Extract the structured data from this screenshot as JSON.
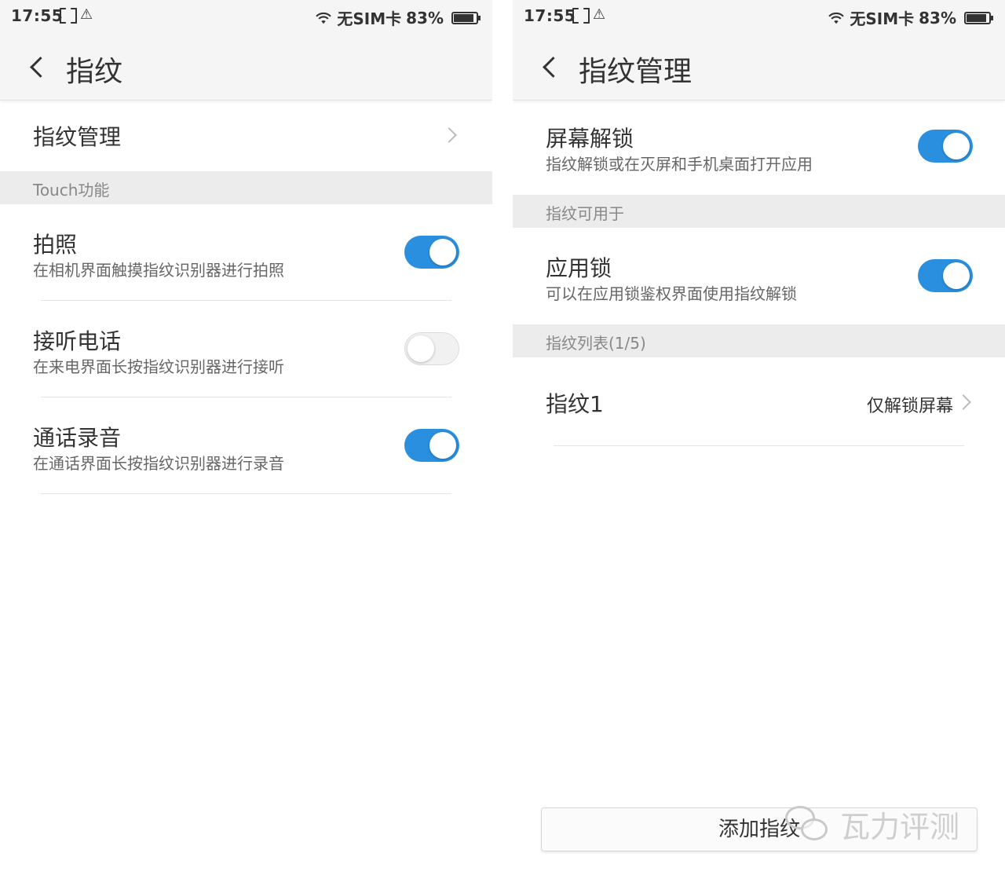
{
  "status": {
    "time": "17:55",
    "carrier": "无SIM卡",
    "battery": "83%",
    "battery_level": 0.83,
    "icons": [
      "screenshot-icon",
      "warning-icon",
      "wifi-icon",
      "battery-icon"
    ]
  },
  "left": {
    "title": "指纹",
    "manage_label": "指纹管理",
    "section_touch": "Touch功能",
    "items": [
      {
        "title": "拍照",
        "subtitle": "在相机界面触摸指纹识别器进行拍照",
        "on": true
      },
      {
        "title": "接听电话",
        "subtitle": "在来电界面长按指纹识别器进行接听",
        "on": false
      },
      {
        "title": "通话录音",
        "subtitle": "在通话界面长按指纹识别器进行录音",
        "on": true
      }
    ]
  },
  "right": {
    "title": "指纹管理",
    "screen_unlock": {
      "title": "屏幕解锁",
      "subtitle": "指纹解锁或在灭屏和手机桌面打开应用",
      "on": true
    },
    "section_usable": "指纹可用于",
    "app_lock": {
      "title": "应用锁",
      "subtitle": "可以在应用锁鉴权界面使用指纹解锁",
      "on": true
    },
    "section_list": "指纹列表(1/5)",
    "fingerprints": [
      {
        "name": "指纹1",
        "value": "仅解锁屏幕"
      }
    ],
    "add_button": "添加指纹"
  },
  "watermark": "瓦力评测",
  "colors": {
    "accent": "#2a8fdf",
    "header_bg": "#f5f5f5",
    "section_bg": "#ececec"
  }
}
